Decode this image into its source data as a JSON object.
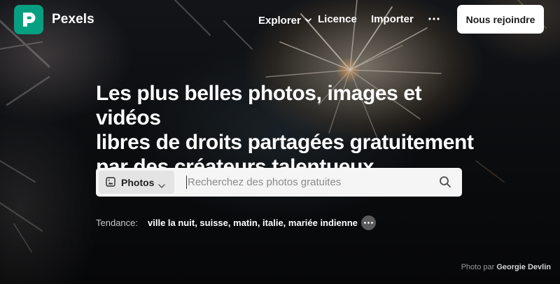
{
  "brand": {
    "name": "Pexels",
    "logo_icon": "pexels-logo-icon",
    "logo_color": "#05a081"
  },
  "nav": {
    "explorer": "Explorer",
    "licence": "Licence",
    "importer": "Importer",
    "more_icon": "more-horizontal-icon",
    "join": "Nous rejoindre"
  },
  "hero": {
    "headline_lines": [
      "Les plus belles photos, images et vidéos",
      "libres de droits partagées gratuitement",
      "par des créateurs talentueux."
    ]
  },
  "search": {
    "type_label": "Photos",
    "type_icon": "image-icon",
    "placeholder": "Recherchez des photos gratuites",
    "value": "",
    "search_icon": "search-icon"
  },
  "trending": {
    "label": "Tendance:",
    "items": [
      "ville la nuit",
      "suisse",
      "matin",
      "italie",
      "mariée indienne"
    ],
    "separator": ", ",
    "more_icon": "more-dots-icon"
  },
  "credit": {
    "prefix": "Photo par",
    "author": "Georgie Devlin"
  },
  "colors": {
    "accent": "#05a081",
    "button_bg": "#ffffff",
    "search_bg": "#f5f5f5"
  }
}
